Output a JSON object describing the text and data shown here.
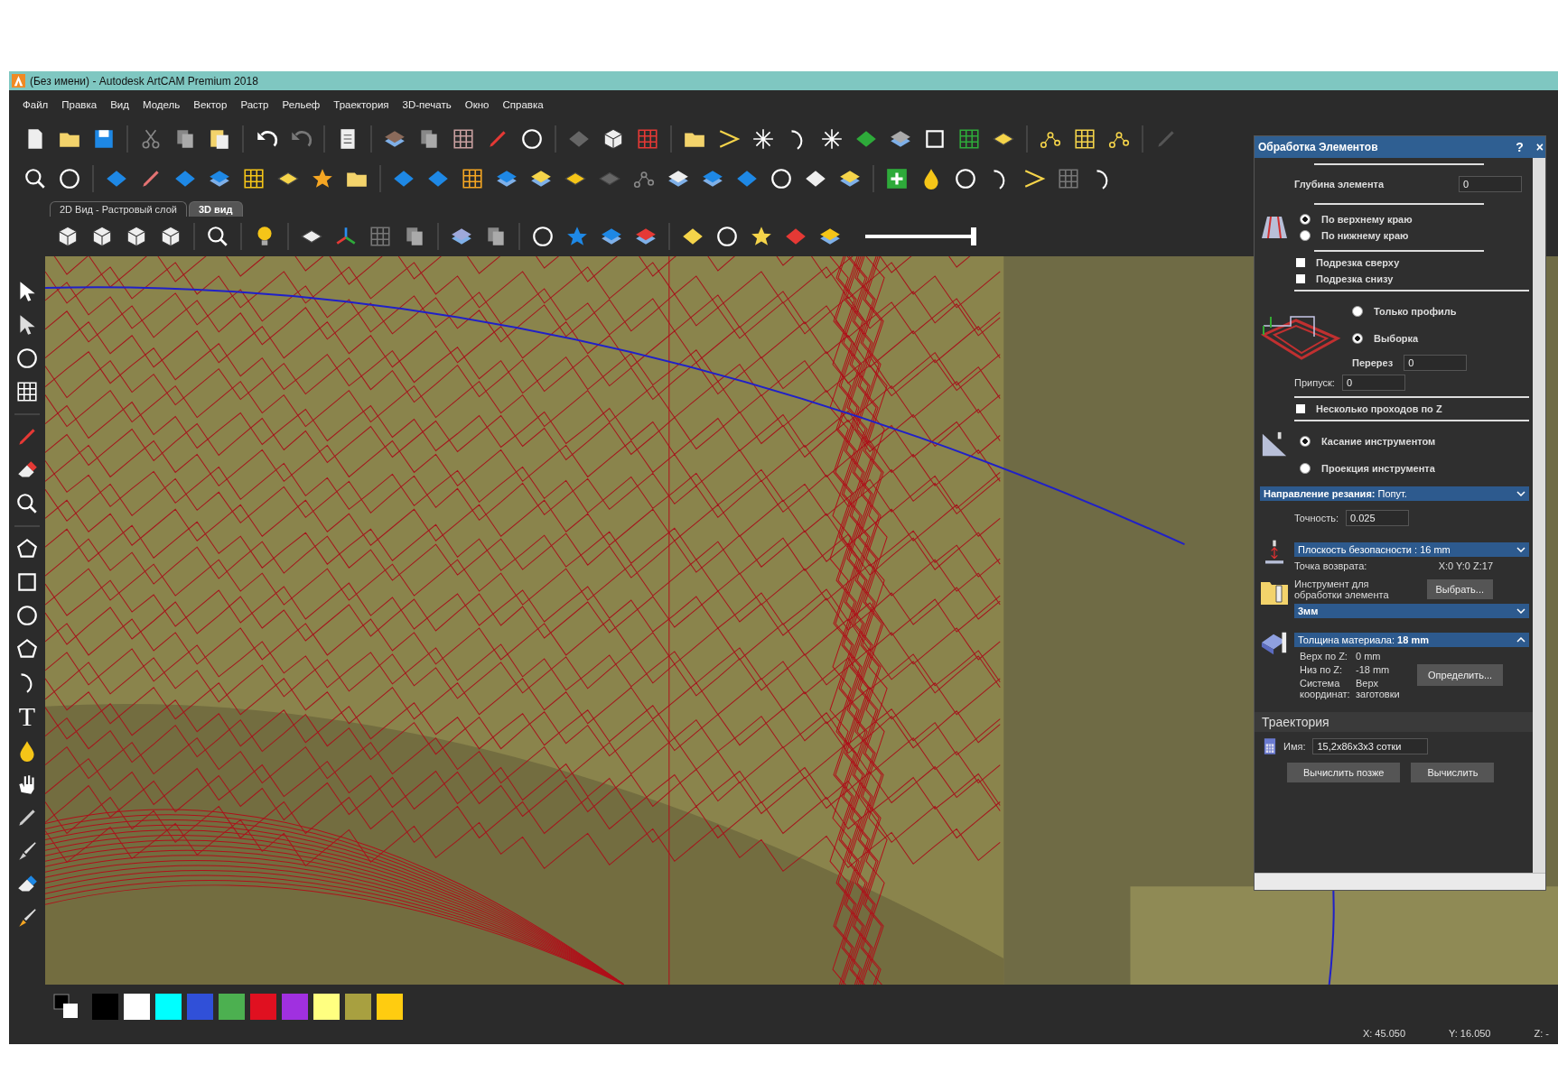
{
  "window": {
    "title": "(Без имени) - Autodesk ArtCAM Premium 2018"
  },
  "menu": [
    "Файл",
    "Правка",
    "Вид",
    "Модель",
    "Вектор",
    "Растр",
    "Рельеф",
    "Траектория",
    "3D-печать",
    "Окно",
    "Справка"
  ],
  "view_tabs": [
    {
      "label": "2D Вид - Растровый слой",
      "selected": false
    },
    {
      "label": "3D вид",
      "selected": true
    }
  ],
  "view_toolbar": {
    "slider": {
      "level": 1
    }
  },
  "left_toolbar": {
    "text_tool": "T"
  },
  "palette": {
    "swatches": [
      {
        "color": "#000000"
      },
      {
        "color": "#ffffff"
      },
      {
        "color": "#00ffff"
      },
      {
        "color": "#3050d8"
      },
      {
        "color": "#4cb050"
      },
      {
        "color": "#e01020"
      },
      {
        "color": "#a030e0"
      },
      {
        "color": "#ffff80"
      },
      {
        "color": "#a8a040"
      },
      {
        "color": "#ffcc10"
      }
    ]
  },
  "panel": {
    "title": "Обработка Элементов",
    "help": "?",
    "close": "×",
    "depth": {
      "label": "Глубина элемента",
      "value": "0"
    },
    "edge_options": [
      {
        "label": "По верхнему краю",
        "selected": true
      },
      {
        "label": "По нижнему краю",
        "selected": false
      }
    ],
    "trims": [
      {
        "label": "Подрезка сверху",
        "checked": false
      },
      {
        "label": "Подрезка снизу",
        "checked": false
      }
    ],
    "strategy": [
      {
        "label": "Только профиль",
        "selected": false
      },
      {
        "label": "Выборка",
        "selected": true
      }
    ],
    "overlap": {
      "label": "Перерез",
      "value": "0"
    },
    "allowance": {
      "label": "Припуск:",
      "value": "0"
    },
    "multi_pass": {
      "label": "Несколько проходов по Z",
      "checked": false
    },
    "contact": [
      {
        "label": "Касание инструментом",
        "selected": true
      },
      {
        "label": "Проекция инструмента",
        "selected": false
      }
    ],
    "cut_direction": {
      "label": "Направление резания:",
      "value": "Попут."
    },
    "accuracy": {
      "label": "Точность:",
      "value": "0.025"
    },
    "safe_plane": {
      "label": "Плоскость безопасности : 16 mm"
    },
    "return_point": {
      "label": "Точка возврата:",
      "value": "X:0 Y:0 Z:17"
    },
    "tool": {
      "label": "Инструмент для обработки элемента",
      "button": "Выбрать..."
    },
    "tool_select": {
      "value": "3мм"
    },
    "material": {
      "header": "Толщина материала: **18 mm**",
      "expanded": true,
      "button": "Определить...",
      "rows": [
        {
          "label": "Верх по Z:",
          "value": "0 mm"
        },
        {
          "label": "Низ по Z:",
          "value": "-18 mm"
        },
        {
          "label": "Система координат:",
          "value": "Верх заготовки"
        }
      ]
    },
    "toolpath": {
      "title": "Траектория",
      "name_label": "Имя:",
      "name_value": "15,2x86x3x3 сотки"
    },
    "buttons": [
      "Вычислить позже",
      "Вычислить"
    ]
  },
  "status_bar": {
    "x": "X: 45.050",
    "y": "Y: 16.050",
    "z": "Z: -"
  }
}
